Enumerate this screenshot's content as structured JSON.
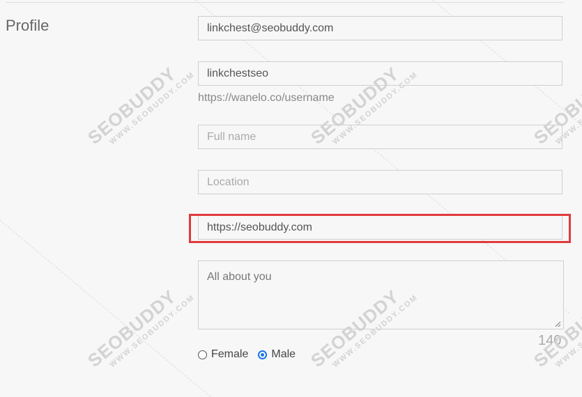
{
  "section_title": "Profile",
  "fields": {
    "email": {
      "value": "linkchest@seobuddy.com",
      "placeholder": ""
    },
    "username": {
      "value": "linkchestseo",
      "placeholder": ""
    },
    "username_hint": "https://wanelo.co/username",
    "full_name": {
      "value": "",
      "placeholder": "Full name"
    },
    "location": {
      "value": "",
      "placeholder": "Location"
    },
    "website": {
      "value": "https://seobuddy.com",
      "placeholder": ""
    },
    "bio": {
      "value": "",
      "placeholder": "All about you"
    }
  },
  "bio_counter": "140",
  "gender": {
    "options": [
      "Female",
      "Male"
    ],
    "selected": "Male"
  },
  "watermark": {
    "brand": "SEOBUDDY",
    "url": "WWW.SEOBUDDY.COM"
  },
  "colors": {
    "highlight": "#e03a3a",
    "radio_selected": "#1a73e8"
  }
}
